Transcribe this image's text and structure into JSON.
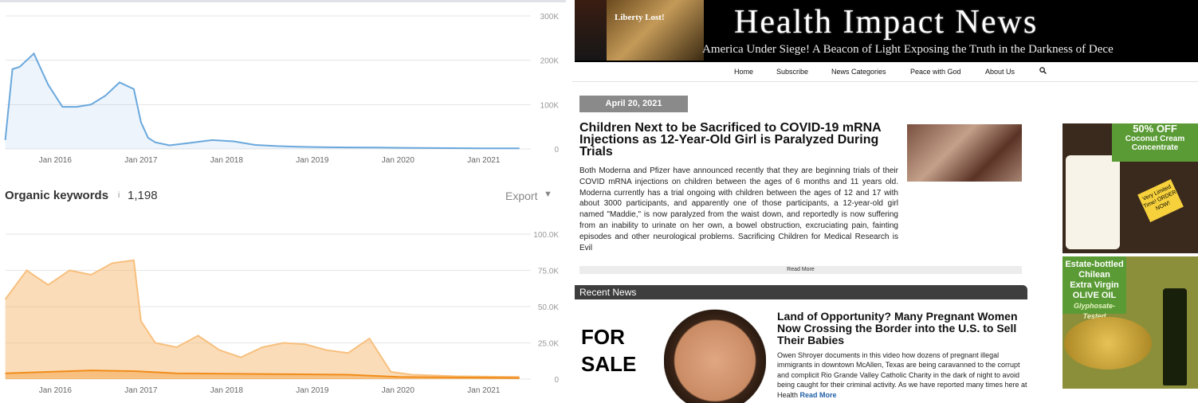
{
  "left_panel": {
    "top_chart": {
      "y_ticks": [
        "300K",
        "200K",
        "100K",
        "0"
      ],
      "x_ticks": [
        "Jan 2016",
        "Jan 2017",
        "Jan 2018",
        "Jan 2019",
        "Jan 2020",
        "Jan 2021"
      ]
    },
    "keywords": {
      "title": "Organic keywords",
      "info": "i",
      "count": "1,198",
      "export_label": "Export",
      "export_caret": "▼"
    },
    "bottom_chart": {
      "y_ticks": [
        "100.0K",
        "75.0K",
        "50.0K",
        "25.0K",
        "0"
      ],
      "x_ticks": [
        "Jan 2016",
        "Jan 2017",
        "Jan 2018",
        "Jan 2019",
        "Jan 2020",
        "Jan 2021"
      ]
    }
  },
  "chart_data": [
    {
      "type": "area",
      "title": "",
      "color": "#6aa8dd",
      "ylim": [
        0,
        300000
      ],
      "grid": true,
      "x": [
        "2015-06",
        "2015-07",
        "2015-08",
        "2015-09",
        "2015-10",
        "2015-12",
        "2016-02",
        "2016-04",
        "2016-06",
        "2016-08",
        "2016-10",
        "2016-12",
        "2017-01",
        "2017-02",
        "2017-03",
        "2017-05",
        "2017-08",
        "2017-11",
        "2018-02",
        "2018-05",
        "2018-08",
        "2018-11",
        "2019-02",
        "2019-06",
        "2019-10",
        "2020-02",
        "2020-06",
        "2021-01",
        "2021-06"
      ],
      "values": [
        20000,
        180000,
        185000,
        200000,
        215000,
        145000,
        95000,
        95000,
        100000,
        120000,
        150000,
        135000,
        60000,
        25000,
        15000,
        8000,
        14000,
        20000,
        17000,
        9000,
        6500,
        5000,
        4000,
        3500,
        3000,
        2500,
        2000,
        1500,
        1200
      ]
    },
    {
      "type": "area",
      "title": "",
      "series": [
        {
          "name": "",
          "color": "#f7c07e",
          "x": [
            "2015-06",
            "2015-09",
            "2015-12",
            "2016-03",
            "2016-06",
            "2016-09",
            "2016-12",
            "2017-01",
            "2017-03",
            "2017-06",
            "2017-09",
            "2017-12",
            "2018-03",
            "2018-06",
            "2018-09",
            "2018-12",
            "2019-03",
            "2019-06",
            "2019-09",
            "2019-12",
            "2020-03",
            "2020-09",
            "2021-06"
          ],
          "values": [
            55000,
            75000,
            65000,
            75000,
            72000,
            80000,
            82000,
            40000,
            25000,
            22000,
            30000,
            20000,
            15000,
            22000,
            25000,
            24000,
            20000,
            18000,
            28000,
            5000,
            3000,
            2000,
            1500
          ]
        },
        {
          "name": "",
          "color": "#f08c1a",
          "x": [
            "2015-06",
            "2016-06",
            "2016-12",
            "2017-06",
            "2018-06",
            "2019-06",
            "2020-01",
            "2021-06"
          ],
          "values": [
            4000,
            6000,
            5500,
            4000,
            3500,
            3000,
            1500,
            800
          ]
        }
      ],
      "ylim": [
        0,
        100000
      ],
      "grid": true
    }
  ],
  "right_panel": {
    "banner": {
      "tag": "Liberty Lost!",
      "title": "Health Impact News",
      "subtitle": "America Under Siege! A Beacon of Light Exposing the Truth in the Darkness of Dece"
    },
    "nav": [
      "Home",
      "Subscribe",
      "News Categories",
      "Peace with God",
      "About Us"
    ],
    "nav_search_icon": "search-icon",
    "article": {
      "date": "April 20, 2021",
      "title": "Children Next to be Sacrificed to COVID-19 mRNA Injections as 12-Year-Old Girl is Paralyzed During Trials",
      "body": "Both Moderna and Pfizer have announced recently that they are beginning trials of their COVID mRNA injections on children between the ages of 6 months and 11 years old. Moderna currently has a trial ongoing with children between the ages of 12 and 17 with about 3000 participants, and apparently one of those participants, a 12-year-old girl named \"Maddie,\" is now paralyzed from the waist down, and reportedly is now suffering from an inability to urinate on her own, a bowel obstruction, excruciating pain, fainting episodes and other neurological problems. Sacrificing Children for Medical Research is Evil",
      "read_more": "Read More"
    },
    "recent_news": {
      "label": "Recent News",
      "image_text": "FOR SALE",
      "title": "Land of Opportunity? Many Pregnant Women Now Crossing the Border into the U.S. to Sell Their Babies",
      "body": "Owen Shroyer documents in this video how dozens of pregnant illegal immigrants in downtown McAllen, Texas are being caravanned to the corrupt and complicit Rio Grande Valley Catholic Charity in the dark of night to avoid being caught for their criminal activity. As we have reported many times here at Health",
      "read_more": "Read More"
    },
    "ads": {
      "ad1": {
        "title": "50% OFF",
        "sub1": "Coconut Cream",
        "sub2": "Concentrate",
        "stamp": "Very Limited Time! ORDER NOW!"
      },
      "ad2": {
        "line1": "Estate-bottled",
        "line2": "Chilean",
        "line3": "Extra Virgin",
        "line4": "OLIVE OIL",
        "line5": "Glyphosate-Tested"
      }
    }
  }
}
